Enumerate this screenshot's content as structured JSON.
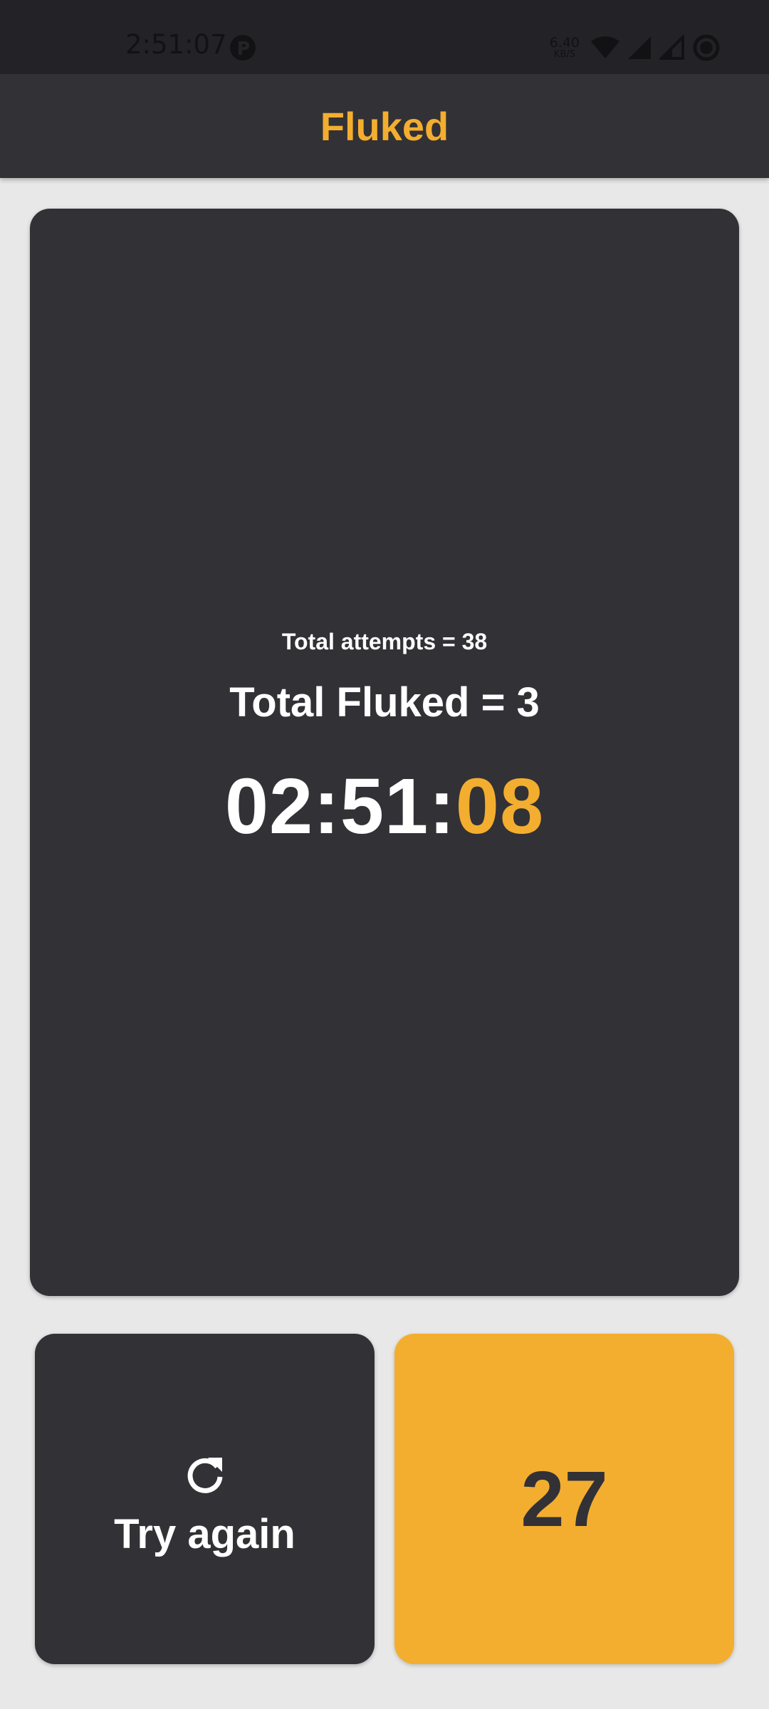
{
  "status_bar": {
    "time": "2:51:07",
    "net_speed_value": "6.40",
    "net_speed_unit": "KB/S",
    "icons": [
      "app-notification-icon",
      "wifi-icon",
      "signal-icon",
      "signal-empty-icon",
      "battery-icon"
    ]
  },
  "app_bar": {
    "title": "Fluked"
  },
  "stats": {
    "attempts": "Total attempts = 38",
    "fluked": "Total Fluked = 3",
    "timer_main": "02:51:",
    "timer_accent": "08"
  },
  "actions": {
    "try_again_label": "Try again",
    "try_again_icon": "refresh-icon",
    "score_value": "27"
  },
  "colors": {
    "accent": "#f3ae2f",
    "surface": "#323136",
    "background": "#e8e8e8",
    "status_bar": "#232327"
  }
}
